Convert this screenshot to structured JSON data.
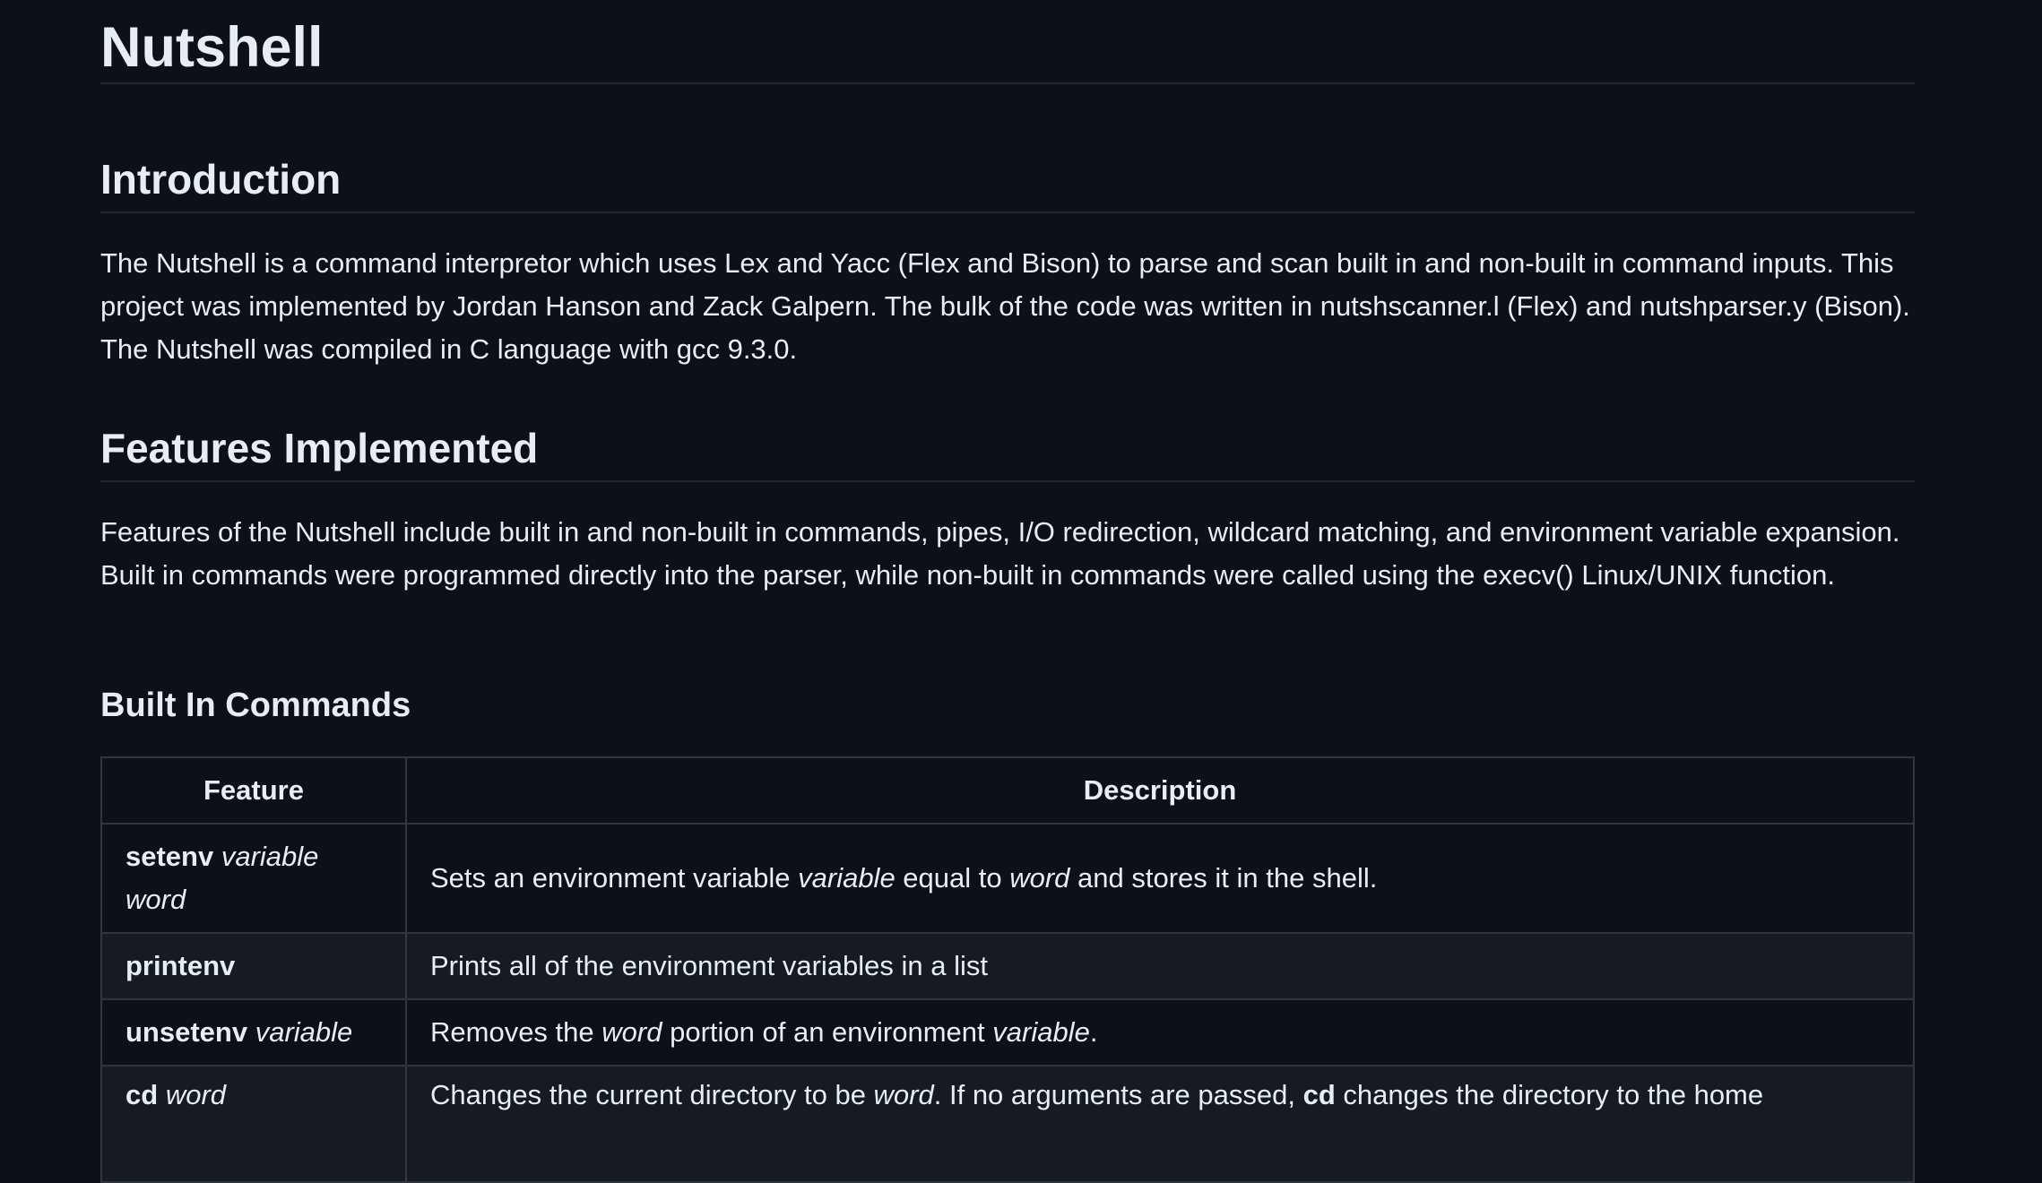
{
  "title": "Nutshell",
  "intro": {
    "heading": "Introduction",
    "body": "The Nutshell is a command interpretor which uses Lex and Yacc (Flex and Bison) to parse and scan built in and non-built in command inputs. This project was implemented by Jordan Hanson and Zack Galpern. The bulk of the code was written in nutshscanner.l (Flex) and nutshparser.y (Bison). The Nutshell was compiled in C language with gcc 9.3.0."
  },
  "features": {
    "heading": "Features Implemented",
    "body": "Features of the Nutshell include built in and non-built in commands, pipes, I/O redirection, wildcard matching, and environment variable expansion. Built in commands were programmed directly into the parser, while non-built in commands were called using the execv() Linux/UNIX function."
  },
  "builtins": {
    "heading": "Built In Commands",
    "col_feature": "Feature",
    "col_description": "Description",
    "rows": [
      {
        "cmd": "setenv",
        "args": "variable word",
        "desc": [
          {
            "t": "Sets an environment variable "
          },
          {
            "t": "variable",
            "s": "i"
          },
          {
            "t": " equal to "
          },
          {
            "t": "word",
            "s": "i"
          },
          {
            "t": " and stores it in the shell."
          }
        ]
      },
      {
        "cmd": "printenv",
        "args": "",
        "desc": [
          {
            "t": "Prints all of the environment variables in a list"
          }
        ]
      },
      {
        "cmd": "unsetenv",
        "args": "variable",
        "desc": [
          {
            "t": "Removes the "
          },
          {
            "t": "word",
            "s": "i"
          },
          {
            "t": " portion of an environment "
          },
          {
            "t": "variable",
            "s": "i"
          },
          {
            "t": "."
          }
        ]
      },
      {
        "cmd": "cd",
        "args": "word",
        "desc": [
          {
            "t": "Changes the current directory to be "
          },
          {
            "t": "word",
            "s": "i"
          },
          {
            "t": ". If no arguments are passed, "
          },
          {
            "t": "cd",
            "s": "b"
          },
          {
            "t": " changes the directory to the home"
          }
        ]
      }
    ]
  }
}
